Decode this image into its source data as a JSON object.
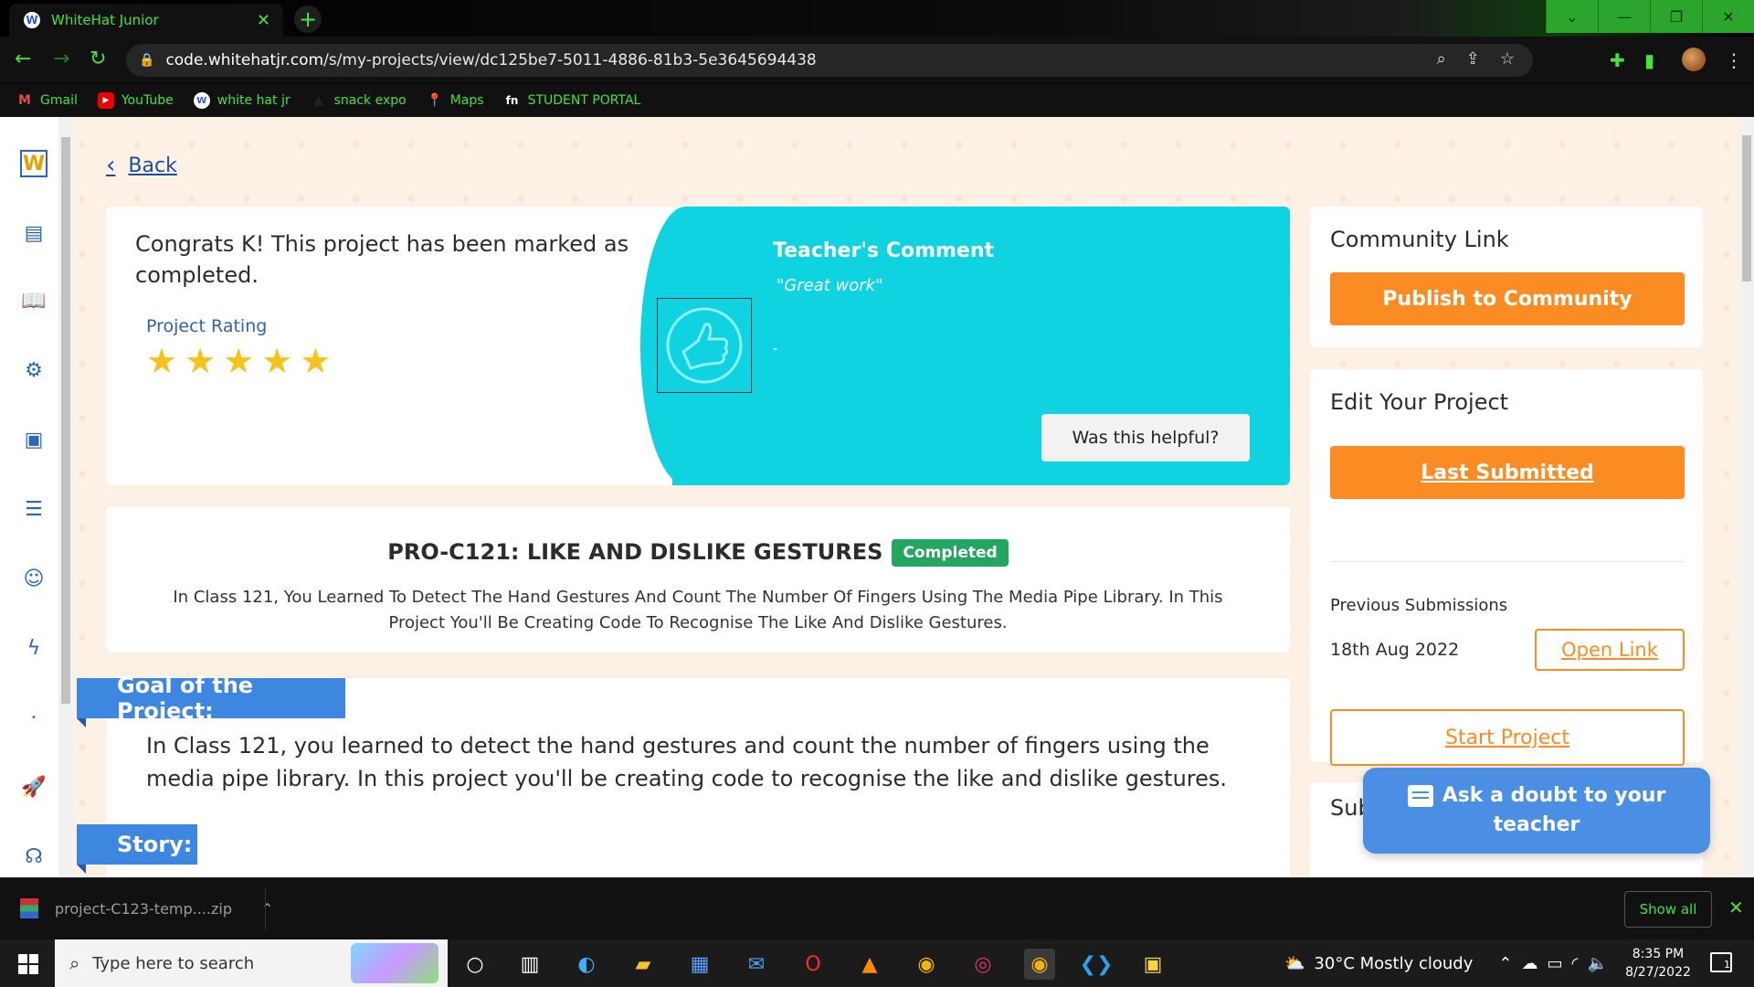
{
  "browser": {
    "tab_title": "WhiteHat Junior",
    "url_host": "code.whitehatjr.com",
    "url_path": "/s/my-projects/view/dc125be7-5011-4886-81b3-5e3645694438",
    "accent_color": "#48e23c"
  },
  "bookmarks": [
    {
      "label": "Gmail",
      "icon": "gmail-icon"
    },
    {
      "label": "YouTube",
      "icon": "youtube-icon"
    },
    {
      "label": "white hat jr",
      "icon": "whitehat-icon"
    },
    {
      "label": "snack expo",
      "icon": "expo-icon"
    },
    {
      "label": "Maps",
      "icon": "maps-icon"
    },
    {
      "label": "STUDENT PORTAL",
      "icon": "portal-icon"
    }
  ],
  "page": {
    "back_label": "Back",
    "congrats": "Congrats K! This project has been marked as completed.",
    "rating_label": "Project Rating",
    "rating": 5,
    "teacher_comment_title": "Teacher's Comment",
    "teacher_comment": "\"Great work\"",
    "teacher_dash": "-",
    "helpful_button": "Was this helpful?",
    "project_title": "PRO-C121: LIKE AND DISLIKE GESTURES",
    "status_badge": "Completed",
    "project_desc": "In Class 121, You Learned To Detect The Hand Gestures And Count The Number Of Fingers Using The Media Pipe Library. In This Project You'll Be Creating Code To Recognise The Like And Dislike Gestures.",
    "goal_heading": "Goal of the Project:",
    "goal_text": "In Class 121, you learned to detect the hand gestures and count the number of fingers using the media pipe library. In this project you'll be creating code to recognise the like and dislike gestures.",
    "story_heading": "Story:"
  },
  "sidebar_right": {
    "community_title": "Community Link",
    "publish_button": "Publish to Community",
    "edit_title": "Edit Your Project",
    "last_submitted_button": "Last Submitted",
    "previous_label": "Previous Submissions",
    "previous_date": "18th Aug 2022",
    "open_link": "Open Link",
    "start_project": "Start Project",
    "sub_title_partial": "Sub",
    "ask_doubt": "Ask a doubt to your teacher"
  },
  "downloads": {
    "file": "project-C123-temp....zip",
    "show_all": "Show all"
  },
  "taskbar": {
    "search_placeholder": "Type here to search",
    "weather": "30°C  Mostly cloudy",
    "time": "8:35 PM",
    "date": "8/27/2022",
    "notifications": "1"
  }
}
